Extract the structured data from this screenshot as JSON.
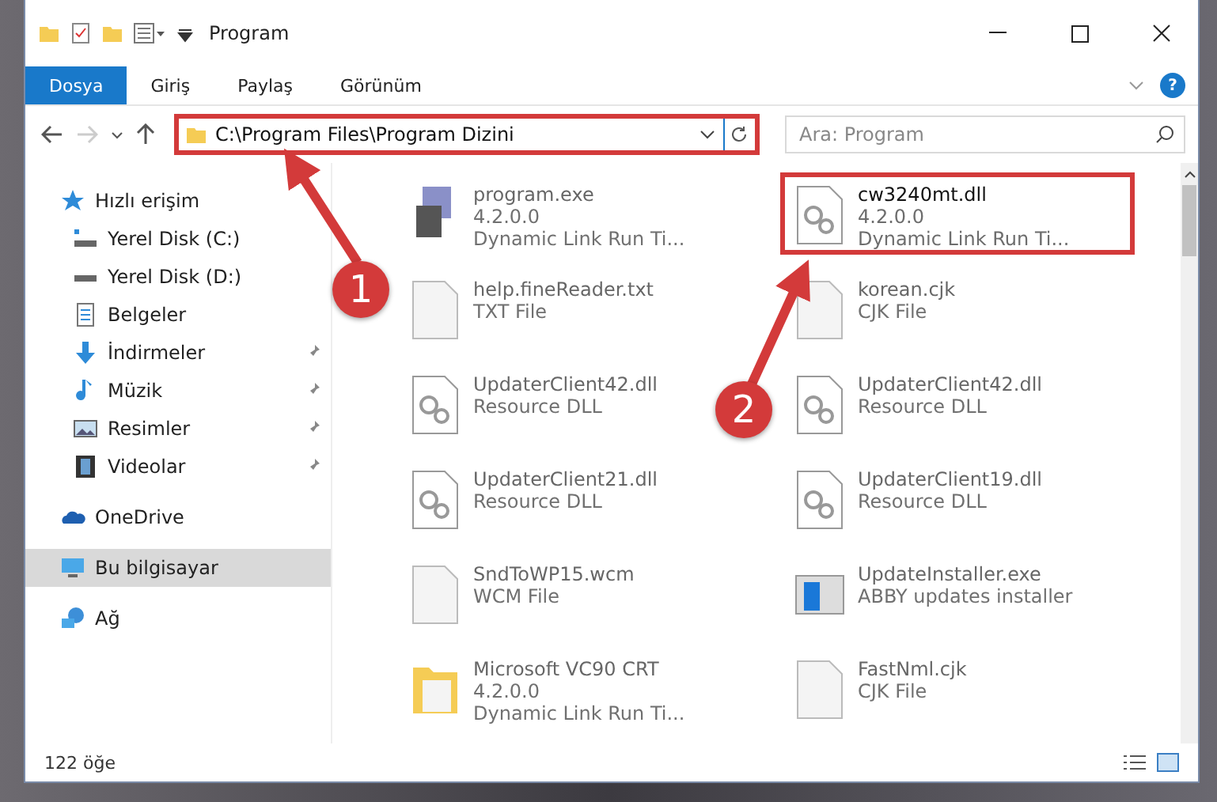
{
  "window": {
    "title": "Program"
  },
  "ribbon": {
    "tabs": [
      {
        "label": "Dosya",
        "selected": true
      },
      {
        "label": "Giriş",
        "selected": false
      },
      {
        "label": "Paylaş",
        "selected": false
      },
      {
        "label": "Görünüm",
        "selected": false
      }
    ],
    "help": "?"
  },
  "address": {
    "path": "C:\\Program Files\\Program Dizini",
    "highlighted": true
  },
  "search": {
    "placeholder": "Ara: Program"
  },
  "sidebar": {
    "items": [
      {
        "label": "Hızlı erişim",
        "kind": "star",
        "pinned": false,
        "selected": false,
        "group": true
      },
      {
        "label": "Yerel Disk (C:)",
        "kind": "drive-os",
        "pinned": false,
        "selected": false,
        "group": false
      },
      {
        "label": "Yerel Disk (D:)",
        "kind": "drive",
        "pinned": false,
        "selected": false,
        "group": false
      },
      {
        "label": "Belgeler",
        "kind": "document",
        "pinned": false,
        "selected": false,
        "group": false
      },
      {
        "label": "İndirmeler",
        "kind": "download",
        "pinned": true,
        "selected": false,
        "group": false
      },
      {
        "label": "Müzik",
        "kind": "music",
        "pinned": true,
        "selected": false,
        "group": false
      },
      {
        "label": "Resimler",
        "kind": "pictures",
        "pinned": true,
        "selected": false,
        "group": false
      },
      {
        "label": "Videolar",
        "kind": "video",
        "pinned": true,
        "selected": false,
        "group": false
      },
      {
        "label": "OneDrive",
        "kind": "cloud",
        "pinned": false,
        "selected": false,
        "group": true
      },
      {
        "label": "Bu bilgisayar",
        "kind": "computer",
        "pinned": false,
        "selected": true,
        "group": true
      },
      {
        "label": "Ağ",
        "kind": "network",
        "pinned": false,
        "selected": false,
        "group": true
      }
    ]
  },
  "files": [
    {
      "name": "program.exe",
      "details": [
        "4.2.0.0",
        "Dynamic Link Run Ti..."
      ],
      "kind": "exe",
      "blurred": true,
      "highlighted": false
    },
    {
      "name": "cw3240mt.dll",
      "details": [
        "4.2.0.0",
        "Dynamic Link Run Ti..."
      ],
      "kind": "dll",
      "blurred": false,
      "highlighted": true
    },
    {
      "name": "help.fineReader.txt",
      "details": [
        "TXT File"
      ],
      "kind": "text",
      "blurred": true,
      "highlighted": false
    },
    {
      "name": "korean.cjk",
      "details": [
        "CJK File"
      ],
      "kind": "text",
      "blurred": true,
      "highlighted": false
    },
    {
      "name": "UpdaterClient42.dll",
      "details": [
        "Resource DLL"
      ],
      "kind": "dll",
      "blurred": true,
      "highlighted": false
    },
    {
      "name": "UpdaterClient42.dll",
      "details": [
        "Resource DLL"
      ],
      "kind": "dll",
      "blurred": true,
      "highlighted": false
    },
    {
      "name": "UpdaterClient21.dll",
      "details": [
        "Resource DLL"
      ],
      "kind": "dll",
      "blurred": true,
      "highlighted": false
    },
    {
      "name": "UpdaterClient19.dll",
      "details": [
        "Resource DLL"
      ],
      "kind": "dll",
      "blurred": true,
      "highlighted": false
    },
    {
      "name": "SndToWP15.wcm",
      "details": [
        "WCM File"
      ],
      "kind": "text",
      "blurred": true,
      "highlighted": false
    },
    {
      "name": "UpdateInstaller.exe",
      "details": [
        "ABBY updates installer"
      ],
      "kind": "installer",
      "blurred": true,
      "highlighted": false
    },
    {
      "name": "Microsoft VC90 CRT",
      "details": [
        "4.2.0.0",
        "Dynamic Link Run Ti..."
      ],
      "kind": "folder",
      "blurred": true,
      "highlighted": false
    },
    {
      "name": "FastNml.cjk",
      "details": [
        "CJK File"
      ],
      "kind": "text",
      "blurred": true,
      "highlighted": false
    }
  ],
  "status_bar": {
    "count": "122 öğe"
  },
  "callouts": [
    {
      "number": "1"
    },
    {
      "number": "2"
    }
  ]
}
